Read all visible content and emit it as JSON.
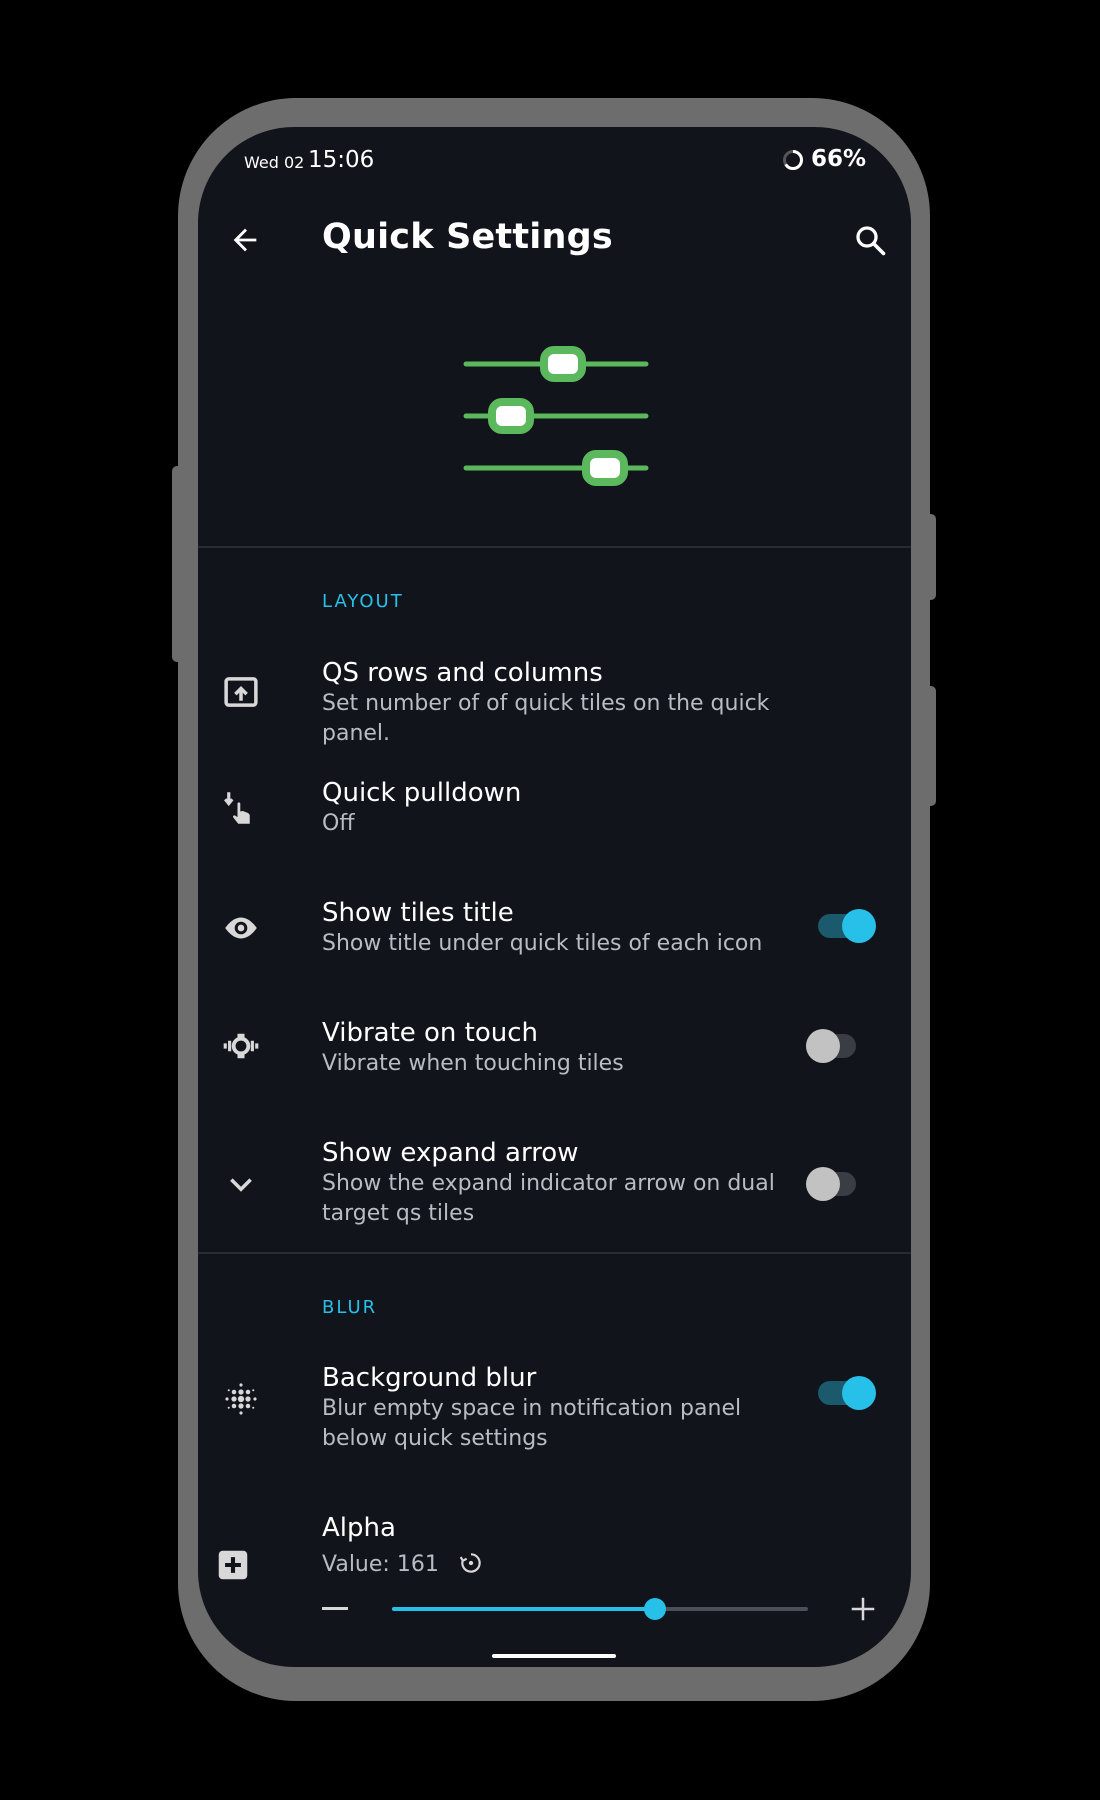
{
  "status_bar": {
    "date": "Wed 02",
    "time": "15:06",
    "battery_percent": "66%",
    "battery_level": 0.66
  },
  "app_bar": {
    "title": "Quick Settings",
    "back_icon": "arrow-back-icon",
    "search_icon": "search-icon"
  },
  "colors": {
    "accent": "#27c0e8",
    "hero_green": "#5cb85c",
    "background": "#11141b"
  },
  "sections": {
    "layout": {
      "label": "LAYOUT",
      "items": [
        {
          "icon": "open-in-panel-icon",
          "title": "QS rows and columns",
          "subtitle": "Set number of of quick tiles on the quick panel."
        },
        {
          "icon": "swipe-down-hand-icon",
          "title": "Quick pulldown",
          "subtitle": "Off"
        },
        {
          "icon": "eye-icon",
          "title": "Show tiles title",
          "subtitle": "Show title under quick tiles of each icon",
          "toggle": true
        },
        {
          "icon": "vibrate-icon",
          "title": "Vibrate on touch",
          "subtitle": "Vibrate when touching tiles",
          "toggle": false
        },
        {
          "icon": "chevron-down-icon",
          "title": "Show expand arrow",
          "subtitle": "Show the expand indicator arrow on dual target qs tiles",
          "toggle": false
        }
      ]
    },
    "blur": {
      "label": "BLUR",
      "items": [
        {
          "icon": "blur-dots-icon",
          "title": "Background blur",
          "subtitle": "Blur empty space in notification panel below quick settings",
          "toggle": true
        }
      ]
    }
  },
  "alpha": {
    "icon": "plus-box-icon",
    "title": "Alpha",
    "value_text": "Value: 161",
    "reset_icon": "reset-icon",
    "value": 161,
    "max": 255,
    "minus_icon": "minus-icon",
    "plus_icon": "plus-icon"
  }
}
